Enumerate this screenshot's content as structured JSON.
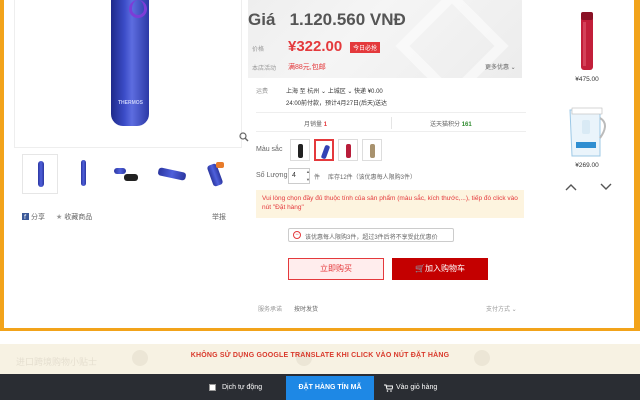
{
  "price_panel": {
    "gia_label": "Giá",
    "vnd_price": "1.120.560 VNĐ",
    "price_label": "价格",
    "promo_price": "¥322.00",
    "badge": "今日必抢",
    "activity_label": "本店活动",
    "activity_text": "满88元,包邮",
    "more_link": "更多优惠"
  },
  "shipping": {
    "label": "运费",
    "route": "上海  至  杭州 ⌄ 上城区 ⌄  快递 ¥0.00",
    "delivery": "24:00前付款，预计4月27日(后天)送达"
  },
  "stats": {
    "monthly_sales_label": "月销量",
    "monthly_sales_value": "1",
    "points_label": "送天猫积分",
    "points_value": "161"
  },
  "options": {
    "color_label": "Màu sắc",
    "qty_label": "Số Lượng",
    "qty_value": "4",
    "qty_unit": "件",
    "stock_text": "库存12件（该优惠每人限购3件）"
  },
  "warning_text": "Vui lòng chọn đầy đủ thuộc tính của sản phẩm (màu sắc, kích thước,...), tiếp đó click vào nút \"Đặt hàng\"",
  "limit_notice": "该优惠每人限购3件，超过3件后将不享受此优惠价",
  "buttons": {
    "buy_now": "立即购买",
    "add_to_cart": "加入购物车"
  },
  "footer_row": {
    "service": "服务承诺",
    "ship_time": "按时发货",
    "payment": "支付方式"
  },
  "left_actions": {
    "share": "分享",
    "favorite": "收藏商品",
    "report": "举报"
  },
  "recommendations": [
    {
      "price": "¥475.00",
      "icon": "red-bottle-icon"
    },
    {
      "price": "¥269.00",
      "icon": "water-pitcher-icon"
    }
  ],
  "bottom": {
    "faint_left": "进口跨境购物小贴士",
    "notice": "KHÔNG SỬ DỤNG GOOGLE TRANSLATE KHI CLICK VÀO NÚT ĐẶT HÀNG",
    "auto_translate": "Dịch tự động",
    "order_button": "ĐẶT HÀNG TÍN MÃ",
    "cart_label": "Vào giỏ hàng"
  },
  "colors": {
    "accent_red": "#e4393c",
    "orange_frame": "#f2a31a",
    "order_blue": "#1e88e5",
    "bar_dark": "#2a2d33"
  }
}
